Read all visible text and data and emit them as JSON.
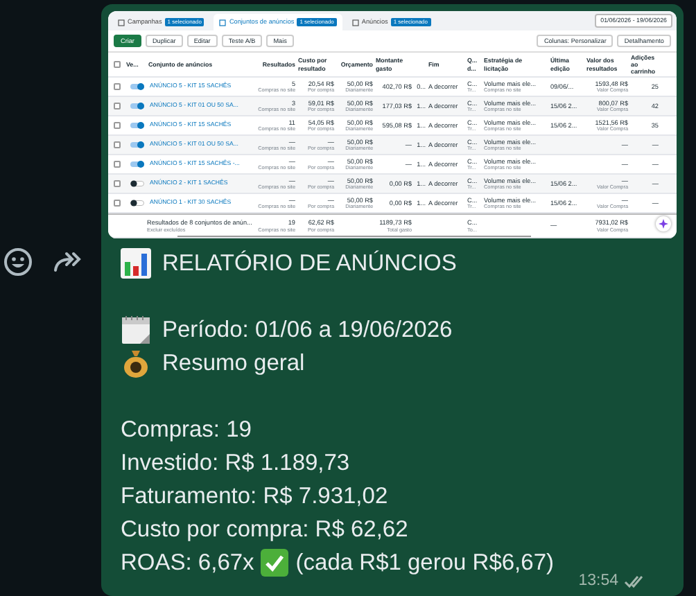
{
  "screenshot": {
    "tabs": [
      {
        "label": "Campanhas",
        "chip": "1 selecionado",
        "selected": false
      },
      {
        "label": "Conjuntos de anúncios",
        "chip": "1 selecionado",
        "selected": true
      },
      {
        "label": "Anúncios",
        "chip": "1 selecionado",
        "selected": false
      }
    ],
    "date_range": "01/06/2026 - 19/06/2026",
    "toolbar": {
      "left": [
        "Criar",
        "Duplicar",
        "Editar",
        "Teste A/B",
        "Mais"
      ],
      "right": [
        "Colunas: Personalizar",
        "Detalhamento"
      ]
    },
    "select_all": {
      "selected": false
    },
    "fixed_columns": [
      "Ve...",
      "Conjunto de anúncios"
    ],
    "columns": [
      {
        "header": "Resultados"
      },
      {
        "header": "Custo por resultado"
      },
      {
        "header": "Orçamento"
      },
      {
        "header": "Montante gasto"
      },
      {},
      {
        "header": "Fim"
      },
      {
        "header": "Q... d..."
      },
      {
        "header": "Estratégia de licitação"
      },
      {
        "header": "Última edição"
      },
      {
        "header": "Valor dos resultados"
      },
      {
        "header": "Adições ao carrinho"
      }
    ],
    "rows": [
      {
        "selected": false,
        "on": true,
        "name": "ANÚNCIO 5 - KIT 15 SACHÊS",
        "cells": [
          {
            "main": "5",
            "sub": "Compras no site"
          },
          {
            "main": "20,54 R$",
            "sub": "Por compra"
          },
          {
            "main": "50,00 R$",
            "sub": "Diariamente"
          },
          {
            "main": "402,70 R$"
          },
          {
            "main": "0..."
          },
          {
            "main": "A decorrer"
          },
          {
            "main": "C...",
            "sub": "Tr..."
          },
          {
            "main": "Volume mais ele...",
            "sub": "Compras no site"
          },
          {
            "main": "09/06/..."
          },
          {
            "main": "1593,48 R$",
            "sub": "Valor Compra"
          },
          {
            "main": "25"
          }
        ]
      },
      {
        "selected": false,
        "on": true,
        "name": "ANÚNCIO 5 - KIT 01 OU 50 SA...",
        "cells": [
          {
            "main": "3",
            "sub": "Compras no site"
          },
          {
            "main": "59,01 R$",
            "sub": "Por compra"
          },
          {
            "main": "50,00 R$",
            "sub": "Diariamente"
          },
          {
            "main": "177,03 R$"
          },
          {
            "main": "1..."
          },
          {
            "main": "A decorrer"
          },
          {
            "main": "C...",
            "sub": "Tr..."
          },
          {
            "main": "Volume mais ele...",
            "sub": "Compras no site"
          },
          {
            "main": "15/06 2..."
          },
          {
            "main": "800,07 R$",
            "sub": "Valor Compra"
          },
          {
            "main": "42"
          }
        ]
      },
      {
        "selected": false,
        "on": true,
        "name": "ANÚNCIO 5 - KIT 15 SACHÊS",
        "cells": [
          {
            "main": "11",
            "sub": "Compras no site"
          },
          {
            "main": "54,05 R$",
            "sub": "Por compra"
          },
          {
            "main": "50,00 R$",
            "sub": "Diariamente"
          },
          {
            "main": "595,08 R$"
          },
          {
            "main": "1..."
          },
          {
            "main": "A decorrer"
          },
          {
            "main": "C...",
            "sub": "Tr..."
          },
          {
            "main": "Volume mais ele...",
            "sub": "Compras no site"
          },
          {
            "main": "15/06 2..."
          },
          {
            "main": "1521,56 R$",
            "sub": "Valor Compra"
          },
          {
            "main": "35"
          }
        ]
      },
      {
        "selected": false,
        "on": true,
        "name": "ANÚNCIO 5 - KIT 01 OU 50 SA...",
        "cells": [
          {
            "main": "—",
            "sub": "Compras no site"
          },
          {
            "main": "—",
            "sub": "Por compra"
          },
          {
            "main": "50,00 R$",
            "sub": "Diariamente"
          },
          {
            "main": "—"
          },
          {
            "main": "1..."
          },
          {
            "main": "A decorrer"
          },
          {
            "main": "C...",
            "sub": "Tr..."
          },
          {
            "main": "Volume mais ele...",
            "sub": "Compras no site"
          },
          null,
          {
            "main": "—"
          },
          {
            "main": "—"
          }
        ]
      },
      {
        "selected": false,
        "on": true,
        "name": "ANÚNCIO 5 - KIT 15 SACHÊS -...",
        "cells": [
          {
            "main": "—",
            "sub": "Compras no site"
          },
          {
            "main": "—",
            "sub": "Por compra"
          },
          {
            "main": "50,00 R$",
            "sub": "Diariamente"
          },
          {
            "main": "—"
          },
          {
            "main": "1..."
          },
          {
            "main": "A decorrer"
          },
          {
            "main": "C...",
            "sub": "Tr..."
          },
          {
            "main": "Volume mais ele...",
            "sub": "Compras no site"
          },
          null,
          {
            "main": "—"
          },
          {
            "main": "—"
          }
        ]
      },
      {
        "selected": false,
        "on": false,
        "name": "ANÚNCIO 2 - KIT 1 SACHÊS",
        "cells": [
          {
            "main": "—",
            "sub": "Compras no site"
          },
          {
            "main": "—",
            "sub": "Por compra"
          },
          {
            "main": "50,00 R$",
            "sub": "Diariamente"
          },
          {
            "main": "0,00 R$"
          },
          {
            "main": "1..."
          },
          {
            "main": "A decorrer"
          },
          {
            "main": "C...",
            "sub": "Tr..."
          },
          {
            "main": "Volume mais ele...",
            "sub": "Compras no site"
          },
          {
            "main": "15/06 2..."
          },
          {
            "main": "—",
            "sub": "Valor Compra"
          },
          {
            "main": "—"
          }
        ]
      },
      {
        "selected": false,
        "on": false,
        "name": "ANÚNCIO 1 - KIT 30 SACHÊS",
        "cells": [
          {
            "main": "—",
            "sub": "Compras no site"
          },
          {
            "main": "—",
            "sub": "Por compra"
          },
          {
            "main": "50,00 R$",
            "sub": "Diariamente"
          },
          {
            "main": "0,00 R$"
          },
          {
            "main": "1..."
          },
          {
            "main": "A decorrer"
          },
          {
            "main": "C...",
            "sub": "Tr..."
          },
          {
            "main": "Volume mais ele...",
            "sub": "Compras no site"
          },
          {
            "main": "15/06 2..."
          },
          {
            "main": "—",
            "sub": "Valor Compra"
          },
          {
            "main": "—"
          }
        ]
      }
    ],
    "footer": {
      "name": "Resultados de 8 conjuntos de anún...",
      "sub": "Excluir excluídos",
      "cells": [
        {
          "main": "19",
          "sub": "Compras no site"
        },
        {
          "main": "62,62 R$",
          "sub": "Por compra"
        },
        null,
        {
          "main": "1189,73 R$",
          "sub": "Total gasto"
        },
        null,
        null,
        {
          "main": "C...",
          "sub": "To..."
        },
        null,
        {
          "main": "—"
        },
        {
          "main": "7931,02 R$",
          "sub": "Valor Compra"
        },
        null
      ]
    }
  },
  "message": {
    "title": "RELATÓRIO DE ANÚNCIOS",
    "period": "Período: 01/06 a 19/06/2026",
    "summary_heading": "Resumo geral",
    "lines": [
      "Compras: 19",
      "Investido: R$ 1.189,73",
      "Faturamento: R$ 7.931,02",
      "Custo por compra: R$ 62,62"
    ],
    "roas": {
      "label": "ROAS: 6,67x",
      "note": "(cada R$1 gerou R$6,67)"
    },
    "time": "13:54",
    "read": false
  }
}
